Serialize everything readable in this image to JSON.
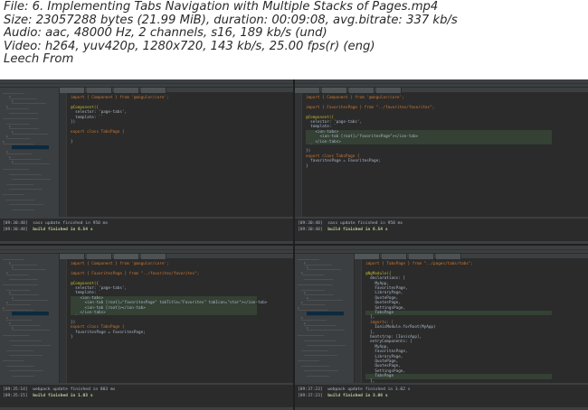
{
  "info": {
    "line1": "File: 6. Implementing Tabs Navigation with Multiple Stacks of Pages.mp4",
    "line2": "Size: 23057288 bytes (21.99 MiB), duration: 00:09:08, avg.bitrate: 337 kb/s",
    "line3": "Audio: aac, 48000 Hz, 2 channels, s16, 189 kb/s (und)",
    "line4": "Video: h264, yuv420p, 1280x720, 143 kb/s, 25.00 fps(r) (eng)",
    "line5": "Leech From"
  },
  "frames": [
    {
      "code": [
        "import { Component } from '@angular/core';",
        "",
        "@Component({",
        "  selector: 'page-tabs',",
        "  template: ``",
        "})",
        "",
        "export class TabsPage {",
        "",
        "}"
      ],
      "highlight": [],
      "term": [
        {
          "time": "[09:30:48]",
          "text": "sass update finished in 950 ms",
          "ok": false
        },
        {
          "time": "[09:30:48]",
          "text": "build finished in 6.54 s",
          "ok": true
        }
      ]
    },
    {
      "code": [
        "import { Component } from '@angular/core';",
        "",
        "import { FavoritesPage } from \"../favorites/favorites\";",
        "",
        "@Component({",
        "  selector: 'page-tabs',",
        "  template: `",
        "    <ion-tabs>",
        "      <ion-tab [root]=\"favoritesPage\"></ion-tab>",
        "    </ion-tabs>",
        "  `",
        "})",
        "export class TabsPage {",
        "  favoritesPage = FavoritesPage;",
        "}"
      ],
      "highlight": [
        7,
        8,
        9
      ],
      "term": [
        {
          "time": "[09:30:48]",
          "text": "sass update finished in 950 ms",
          "ok": false
        },
        {
          "time": "[09:30:48]",
          "text": "build finished in 6.54 s",
          "ok": true
        }
      ]
    },
    {
      "code": [
        "import { Component } from '@angular/core';",
        "",
        "import { FavoritesPage } from \"../favorites/favorites\";",
        "",
        "@Component({",
        "  selector: 'page-tabs',",
        "  template: `",
        "    <ion-tabs>",
        "      <ion-tab [root]=\"favoritesPage\" tabTitle=\"Favorites\" tabIcon=\"star\"></ion-tab>",
        "      <ion-tab [root]></ion-tab>",
        "    </ion-tabs>",
        "  `",
        "})",
        "export class TabsPage {",
        "  favoritesPage = FavoritesPage;",
        "}"
      ],
      "highlight": [
        7,
        8,
        9,
        10
      ],
      "term": [
        {
          "time": "[09:35:14]",
          "text": "webpack update finished in 803 ms",
          "ok": false
        },
        {
          "time": "[09:35:15]",
          "text": "build finished in 1.03 s",
          "ok": true
        }
      ]
    },
    {
      "code": [
        "import { TabsPage } from \"../pages/tabs/tabs\";",
        "",
        "@NgModule({",
        "  declarations: [",
        "    MyApp,",
        "    FavoritesPage,",
        "    LibraryPage,",
        "    QuotePage,",
        "    QuotesPage,",
        "    SettingsPage,",
        "    TabsPage",
        "  ],",
        "  imports: [",
        "    IonicModule.forRoot(MyApp)",
        "  ],",
        "  bootstrap: [IonicApp],",
        "  entryComponents: [",
        "    MyApp,",
        "    FavoritesPage,",
        "    LibraryPage,",
        "    QuotePage,",
        "    QuotesPage,",
        "    SettingsPage,",
        "    TabsPage",
        "  ],",
        "  providers: [{provide: ErrorHandler, useClass: IonicErrorHandler}]"
      ],
      "highlight": [
        10,
        23
      ],
      "term": [
        {
          "time": "[09:37:23]",
          "text": "webpack update finished in 3.02 s",
          "ok": false
        },
        {
          "time": "[09:37:23]",
          "text": "build finished in 3.06 s",
          "ok": true
        }
      ]
    }
  ]
}
